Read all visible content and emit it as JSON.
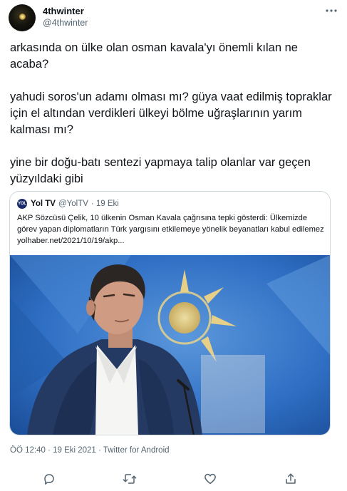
{
  "author": {
    "display_name": "4thwinter",
    "handle": "@4thwinter"
  },
  "tweet": {
    "paragraphs": [
      "arkasında on ülke olan osman kavala'yı önemli kılan ne acaba?",
      "yahudi soros'un adamı olması mı? güya vaat edilmiş topraklar için el altından verdikleri ülkeyi bölme uğraşlarının yarım kalması mı?",
      "yine bir doğu-batı sentezi yapmaya talip olanlar var geçen yüzyıldaki gibi"
    ]
  },
  "quoted_tweet": {
    "avatar_text": "YOL",
    "display_name": "Yol TV",
    "handle": "@YolTV",
    "date": "· 19 Eki",
    "text": "AKP Sözcüsü Çelik, 10 ülkenin Osman Kavala çağrısına tepki gösterdi: Ülkemizde görev yapan diplomatların Türk yargısını etkilemeye yönelik beyanatları kabul edilemez yolhaber.net/2021/10/19/akp..."
  },
  "timestamp_line": "ÖÖ 12:40 · 19 Eki 2021 · Twitter for Android",
  "icons": {
    "more": "more-dots-icon",
    "reply": "reply-icon",
    "retweet": "retweet-icon",
    "like": "heart-icon",
    "share": "share-icon"
  },
  "colors": {
    "text": "#0f1419",
    "secondary": "#536471",
    "border": "#cfd9de",
    "photo_background": "#2f6fc4"
  }
}
